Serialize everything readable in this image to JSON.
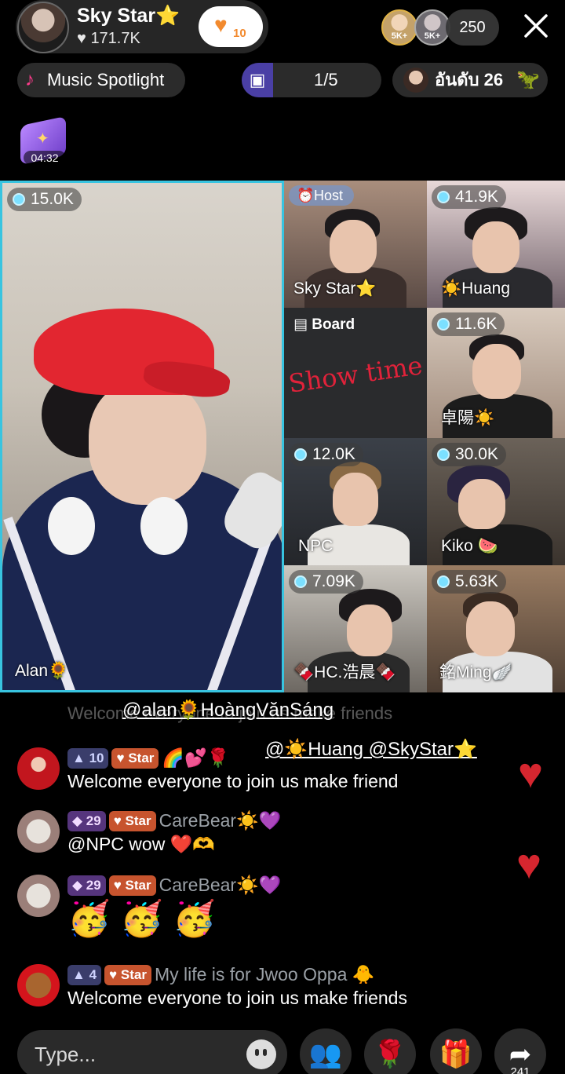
{
  "header": {
    "host_name": "Sky Star⭐",
    "host_likes": "171.7K",
    "like_button_count": "10",
    "viewer_badges": [
      "5K+",
      "5K+"
    ],
    "viewer_count": "250"
  },
  "controls": {
    "music_label": "Music Spotlight",
    "board_progress": "1/5",
    "rank_label": "อันดับ 26",
    "gift_timer": "04:32"
  },
  "tiles": {
    "main": {
      "views": "15.0K",
      "name": "Alan🌻"
    },
    "host": {
      "badge": "Host",
      "name": "Sky Star⭐"
    },
    "huang": {
      "views": "41.9K",
      "name": "☀️Huang"
    },
    "board": {
      "label": "Board",
      "text": "Show time"
    },
    "zhuo": {
      "views": "11.6K",
      "name": "卓陽☀️"
    },
    "npc": {
      "views": "12.0K",
      "name": "NPC"
    },
    "kiko": {
      "views": "30.0K",
      "name": "Kiko 🍉"
    },
    "hc": {
      "views": "7.09K",
      "name": "🍫HC.浩晨🍫"
    },
    "ming": {
      "views": "5.63K",
      "name": "銘Ming🪽"
    }
  },
  "chat": {
    "mention1": "@alan🌻HoàngVănSáng",
    "mention2": "@☀️Huang @SkyStar⭐",
    "faded_line": "Welcome everyone to join us make friends",
    "messages": [
      {
        "level": "10",
        "tag": "Star",
        "user": "🌈💕🌹",
        "text": "Welcome everyone to join us make friend"
      },
      {
        "level": "29",
        "tag": "Star",
        "user": "CareBear☀️💜",
        "text": "@NPC wow ❤️🫶"
      },
      {
        "level": "29",
        "tag": "Star",
        "user": "CareBear☀️💜",
        "text": "🥳 🥳 🥳"
      },
      {
        "level": "4",
        "tag": "Star",
        "user": "My life is for Jwoo Oppa 🐥",
        "text": "Welcome everyone to join us make friends"
      }
    ]
  },
  "bottom": {
    "input_placeholder": "Type...",
    "share_count": "241"
  },
  "colors": {
    "accent_cyan": "#38c4e0",
    "heart_red": "#d6262f",
    "star_tag": "#c7542e"
  }
}
